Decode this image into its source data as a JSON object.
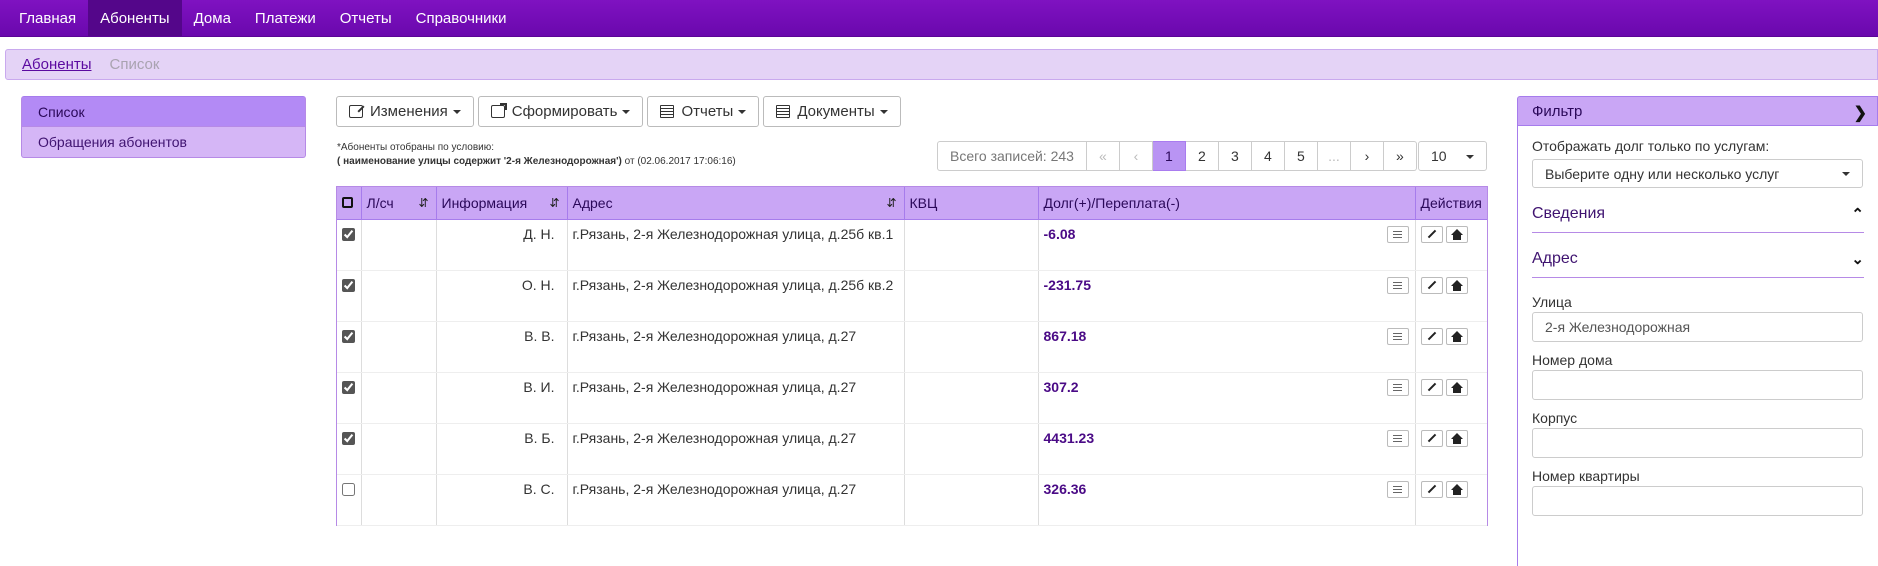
{
  "nav": {
    "items": [
      "Главная",
      "Абоненты",
      "Дома",
      "Платежи",
      "Отчеты",
      "Справочники"
    ],
    "active": 1
  },
  "breadcrumb": {
    "link": "Абоненты",
    "current": "Список"
  },
  "leftmenu": {
    "items": [
      "Список",
      "Обращения абонентов"
    ]
  },
  "toolbar": {
    "changes": "Изменения",
    "generate": "Сформировать",
    "reports": "Отчеты",
    "documents": "Документы"
  },
  "condition": {
    "line1": "*Абоненты отобраны по условию:",
    "line2_bold": "( наименование улицы содержит '2-я Железнодорожная')",
    "line2_rest": " от (02.06.2017 17:06:16)"
  },
  "pager": {
    "total": "Всего записей: 243",
    "first": "«",
    "prev": "‹",
    "pages": [
      "1",
      "2",
      "3",
      "4",
      "5",
      "..."
    ],
    "next": "›",
    "last": "»",
    "page_size": "10"
  },
  "table": {
    "headers": {
      "account": "Л/сч",
      "info": "Информация",
      "address": "Адрес",
      "kvc": "КВЦ",
      "debt": "Долг(+)/Переплата(-)",
      "actions": "Действия"
    },
    "rows": [
      {
        "checked": true,
        "account": "",
        "info": "Д. Н.",
        "address": "г.Рязань, 2-я Железнодорожная улица, д.25б кв.1",
        "kvc": "",
        "debt": "-6.08"
      },
      {
        "checked": true,
        "account": "",
        "info": "О. Н.",
        "address": "г.Рязань, 2-я Железнодорожная улица, д.25б кв.2",
        "kvc": "",
        "debt": "-231.75"
      },
      {
        "checked": true,
        "account": "",
        "info": "В. В.",
        "address": "г.Рязань, 2-я Железнодорожная улица, д.27",
        "kvc": "",
        "debt": "867.18"
      },
      {
        "checked": true,
        "account": "",
        "info": "В. И.",
        "address": "г.Рязань, 2-я Железнодорожная улица, д.27",
        "kvc": "",
        "debt": "307.2"
      },
      {
        "checked": true,
        "account": "",
        "info": "В. Б.",
        "address": "г.Рязань, 2-я Железнодорожная улица, д.27",
        "kvc": "",
        "debt": "4431.23"
      },
      {
        "checked": false,
        "account": "",
        "info": "В. С.",
        "address": "г.Рязань, 2-я Железнодорожная улица, д.27",
        "kvc": "",
        "debt": "326.36"
      }
    ]
  },
  "filter": {
    "title": "Фильтр",
    "debt_label": "Отображать долг только по услугам:",
    "services_placeholder": "Выберите одну или несколько услуг",
    "section_info": "Сведения",
    "section_address": "Адрес",
    "street_label": "Улица",
    "street_value": "2-я Железнодорожная",
    "house_label": "Номер дома",
    "house_value": "",
    "building_label": "Корпус",
    "building_value": "",
    "apartment_label": "Номер квартиры",
    "apartment_value": ""
  }
}
